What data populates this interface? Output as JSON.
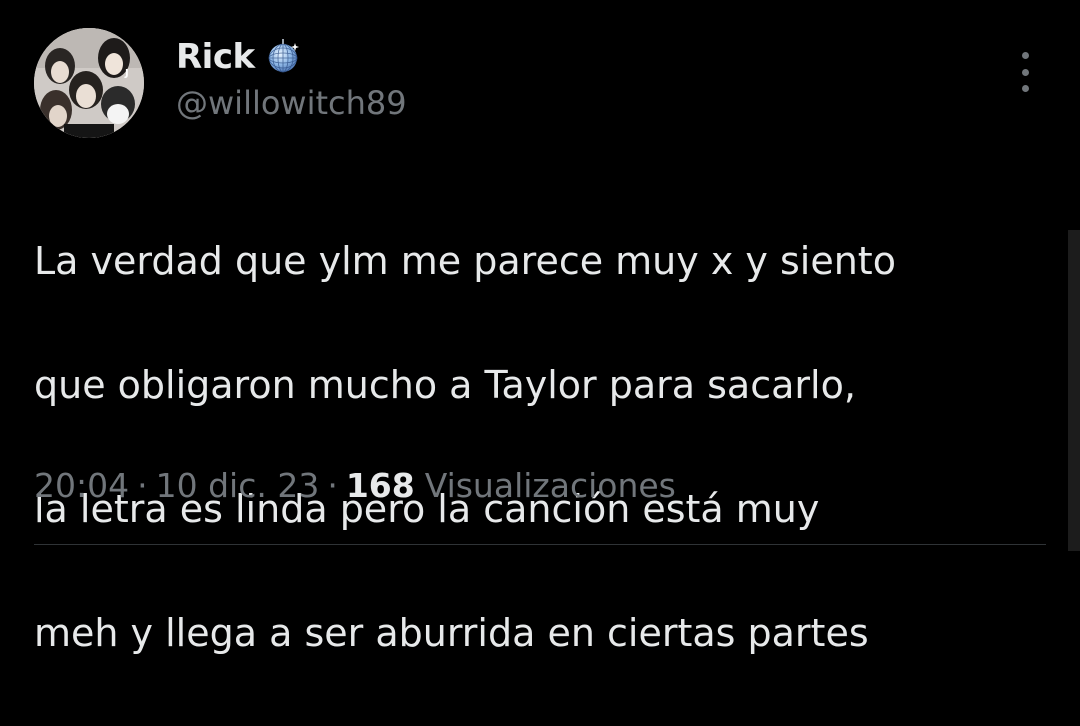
{
  "author": {
    "display_name": "Rick",
    "handle": "@willowitch89",
    "badge_icon": "mirror-ball-icon",
    "avatar_icon": "group-photo-avatar"
  },
  "tweet": {
    "lines": [
      "La verdad que ylm me parece muy x y siento",
      "que obligaron mucho a Taylor para sacarlo,",
      "la letra es linda pero la canción está muy",
      "meh y llega a ser aburrida en ciertas partes"
    ],
    "time": "20:04",
    "separator": "·",
    "date": "10 dic. 23",
    "views_count": "168",
    "views_label": "Visualizaciones"
  },
  "colors": {
    "background": "#000000",
    "text_primary": "#e7e9ea",
    "text_secondary": "#71767b",
    "divider": "#2f3336"
  },
  "more_menu_icon": "more-vertical-icon"
}
